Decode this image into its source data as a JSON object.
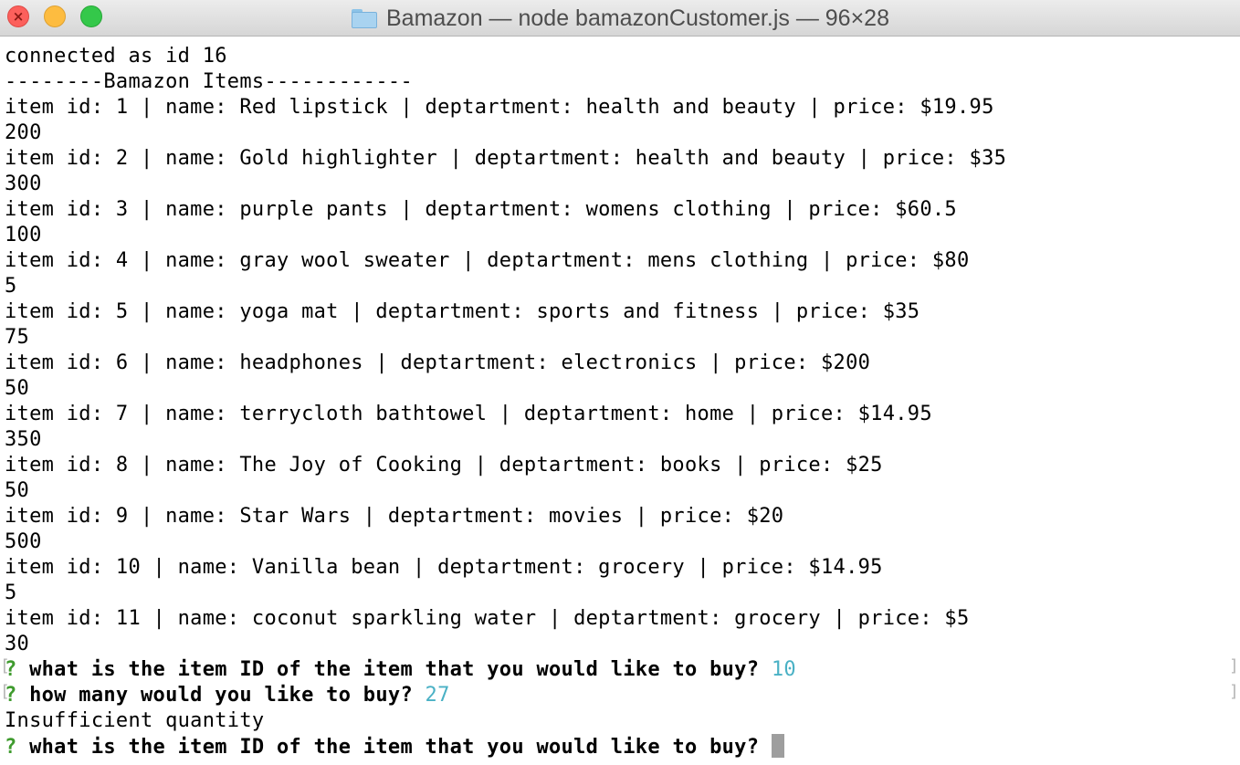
{
  "window": {
    "title": "Bamazon — node bamazonCustomer.js — 96×28"
  },
  "terminal": {
    "lines": [
      "connected as id 16",
      "--------Bamazon Items------------",
      "item id: 1 | name: Red lipstick | deptartment: health and beauty | price: $19.95",
      "200",
      "item id: 2 | name: Gold highlighter | deptartment: health and beauty | price: $35",
      "300",
      "item id: 3 | name: purple pants | deptartment: womens clothing | price: $60.5",
      "100",
      "item id: 4 | name: gray wool sweater | deptartment: mens clothing | price: $80",
      "5",
      "item id: 5 | name: yoga mat | deptartment: sports and fitness | price: $35",
      "75",
      "item id: 6 | name: headphones | deptartment: electronics | price: $200",
      "50",
      "item id: 7 | name: terrycloth bathtowel | deptartment: home | price: $14.95",
      "350",
      "item id: 8 | name: The Joy of Cooking | deptartment: books | price: $25",
      "50",
      "item id: 9 | name: Star Wars | deptartment: movies | price: $20",
      "500",
      "item id: 10 | name: Vanilla bean | deptartment: grocery | price: $14.95",
      "5",
      "item id: 11 | name: coconut sparkling water | deptartment: grocery | price: $5",
      "30"
    ],
    "prompts": [
      {
        "mark": "?",
        "question": "what is the item ID of the item that you would like to buy?",
        "answer": "10"
      },
      {
        "mark": "?",
        "question": "how many would you like to buy?",
        "answer": "27"
      }
    ],
    "message": "Insufficient quantity",
    "final_prompt": {
      "mark": "?",
      "question": "what is the item ID of the item that you would like to buy?"
    }
  },
  "colors": {
    "prompt_mark": "#3f9b2e",
    "answer": "#4ab1c5",
    "cursor": "#9e9e9e"
  }
}
